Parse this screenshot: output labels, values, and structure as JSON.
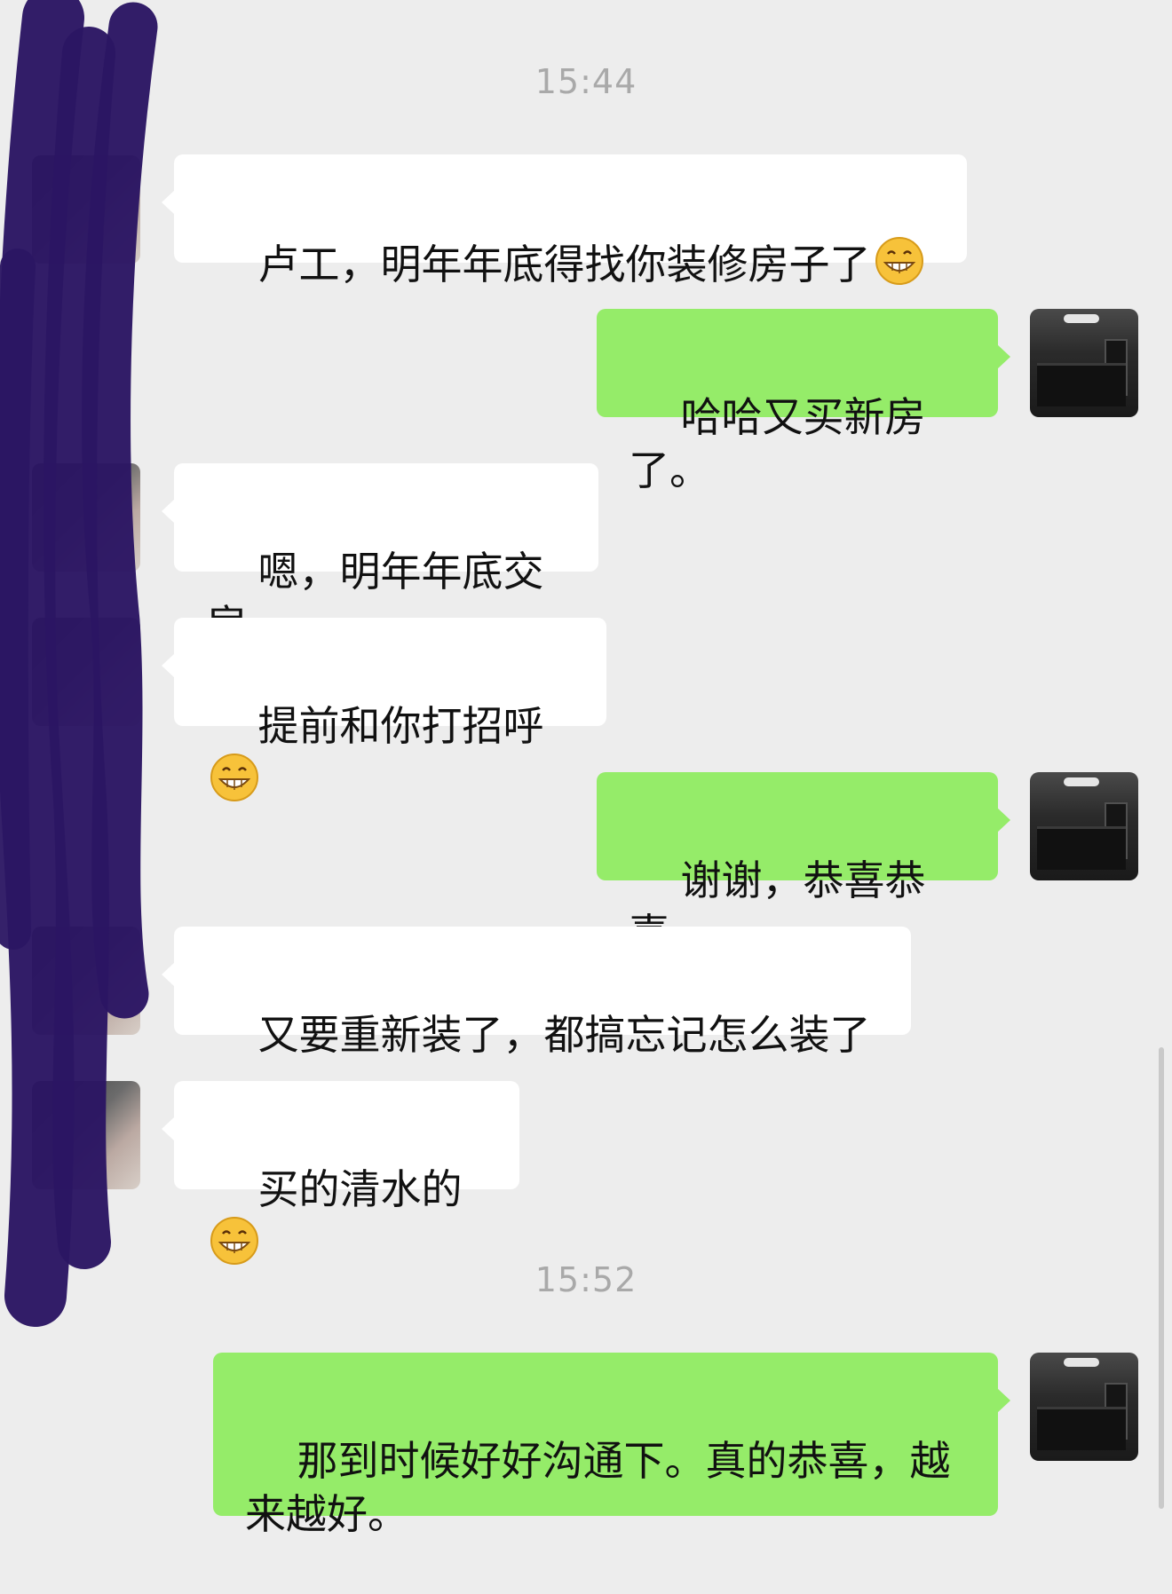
{
  "chat": {
    "timestamps": [
      "15:44",
      "15:52"
    ],
    "messages": [
      {
        "side": "them",
        "text": "卢工，明年年底得找你装修房子了",
        "emoji": "grin-emoji"
      },
      {
        "side": "me",
        "text": "哈哈又买新房了。"
      },
      {
        "side": "them",
        "text": "嗯，明年年底交房"
      },
      {
        "side": "them",
        "text": "提前和你打招呼",
        "emoji": "grin-emoji"
      },
      {
        "side": "me",
        "text": "谢谢，恭喜恭喜。"
      },
      {
        "side": "them",
        "text": "又要重新装了，都搞忘记怎么装了"
      },
      {
        "side": "them",
        "text": "买的清水的",
        "emoji": "grin-emoji"
      },
      {
        "side": "me",
        "text": "那到时候好好沟通下。真的恭喜，越\n来越好。"
      }
    ]
  },
  "colors": {
    "background": "#ededed",
    "my_bubble": "#95ec69",
    "their_bubble": "#ffffff",
    "redaction": "#2b1663"
  }
}
